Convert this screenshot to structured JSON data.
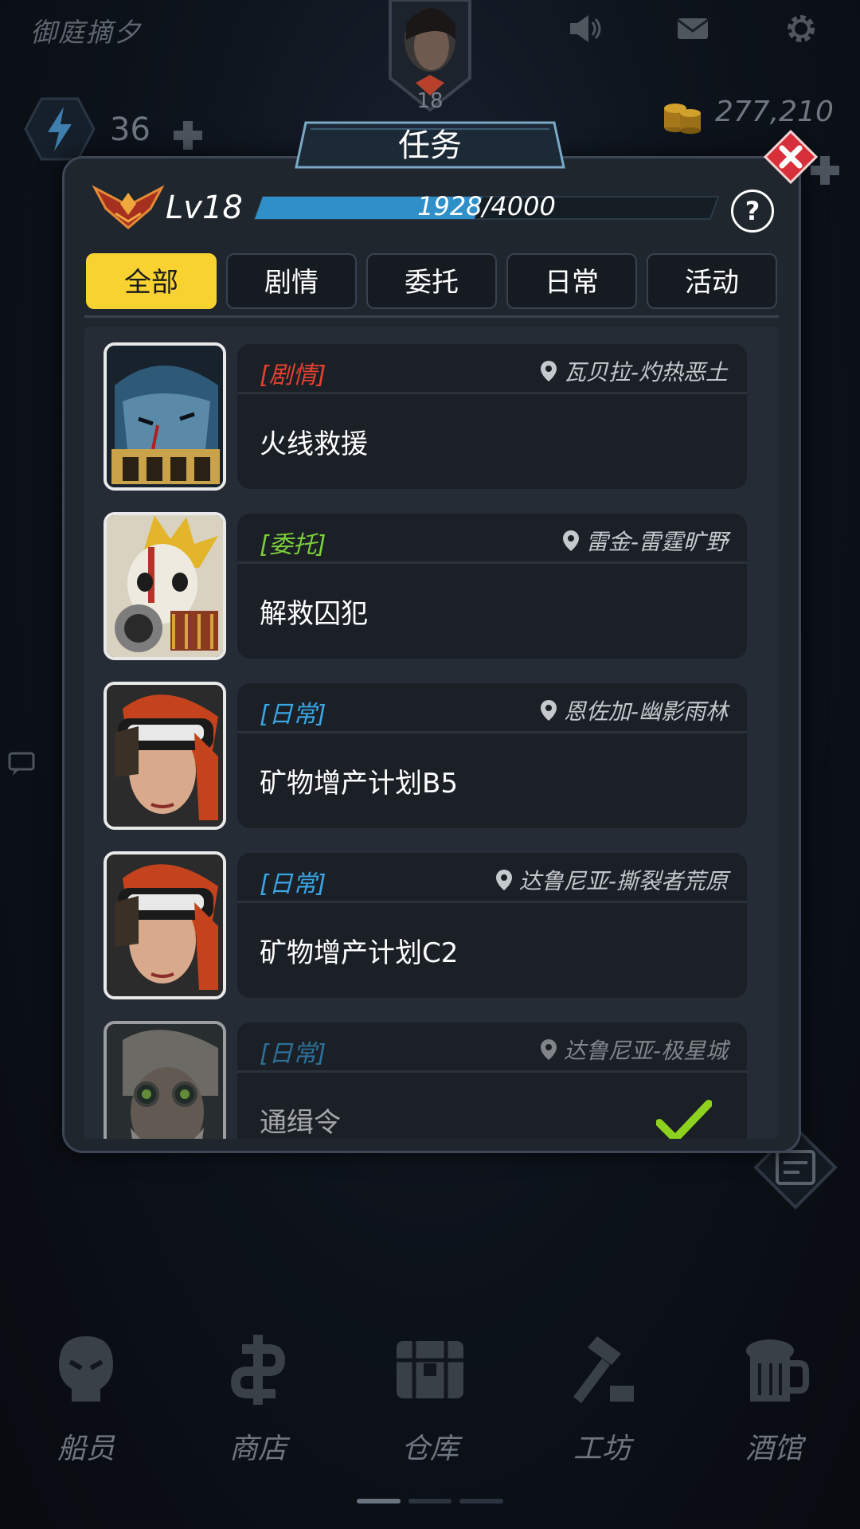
{
  "header": {
    "player_name": "御庭摘夕",
    "player_level": "18",
    "energy": "36",
    "coins": "277,210",
    "icons": [
      "speaker-icon",
      "mail-icon",
      "gear-icon"
    ]
  },
  "dialog": {
    "title": "任务",
    "level_label": "Lv18",
    "xp_text": "1928/4000",
    "xp_progress": 0.482,
    "help_label": "?",
    "tabs": [
      {
        "label": "全部",
        "active": true
      },
      {
        "label": "剧情",
        "active": false
      },
      {
        "label": "委托",
        "active": false
      },
      {
        "label": "日常",
        "active": false
      },
      {
        "label": "活动",
        "active": false
      }
    ],
    "quests": [
      {
        "type": "[剧情]",
        "type_color": "#e5412f",
        "location": "瓦贝拉-灼热恶土",
        "name": "火线救援",
        "completed": false
      },
      {
        "type": "[委托]",
        "type_color": "#7ccf3a",
        "location": "雷金-雷霆旷野",
        "name": "解救囚犯",
        "completed": false
      },
      {
        "type": "[日常]",
        "type_color": "#3aa6e6",
        "location": "恩佐加-幽影雨林",
        "name": "矿物增产计划B5",
        "completed": false
      },
      {
        "type": "[日常]",
        "type_color": "#3aa6e6",
        "location": "达鲁尼亚-撕裂者荒原",
        "name": "矿物增产计划C2",
        "completed": false
      },
      {
        "type": "[日常]",
        "type_color": "#3aa6e6",
        "location": "达鲁尼亚-极星城",
        "name": "通缉令",
        "completed": true
      }
    ]
  },
  "nav": {
    "items": [
      {
        "label": "船员",
        "icon": "crew-icon"
      },
      {
        "label": "商店",
        "icon": "shop-icon"
      },
      {
        "label": "仓库",
        "icon": "warehouse-icon"
      },
      {
        "label": "工坊",
        "icon": "workshop-icon"
      },
      {
        "label": "酒馆",
        "icon": "tavern-icon"
      }
    ]
  },
  "colors": {
    "accent_yellow": "#f8d231",
    "xp_fill": "#2f8fc8",
    "close_red": "#d8303a"
  }
}
